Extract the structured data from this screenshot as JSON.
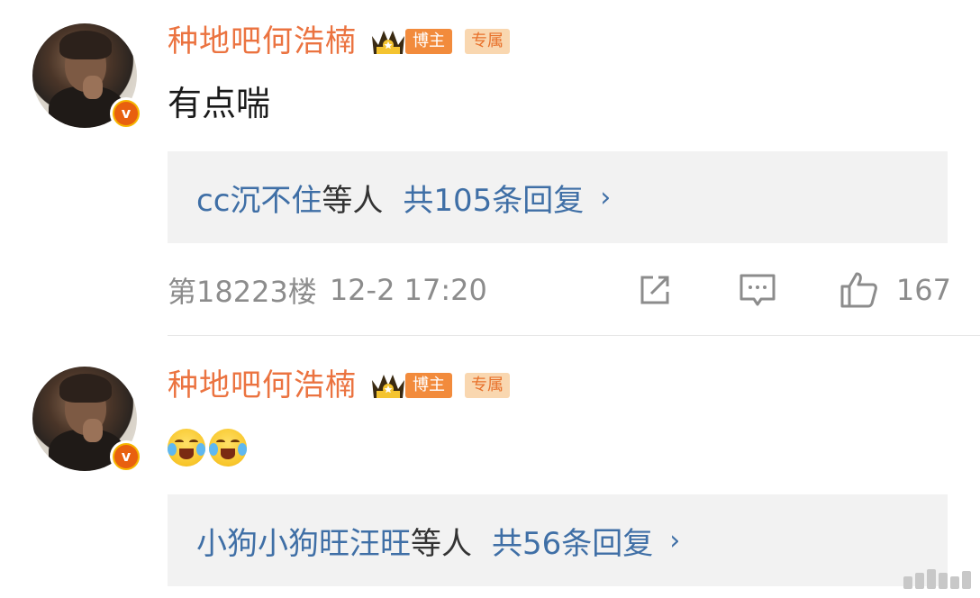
{
  "comments": [
    {
      "username": "种地吧何浩楠",
      "badge_blogger": "博主",
      "badge_exclusive": "专属",
      "text": "有点喘",
      "replies": {
        "names": "cc沉不住",
        "others": "等人",
        "count": "共105条回复",
        "chevron": "›"
      },
      "floor": "第18223楼",
      "time": "12-2 17:20",
      "likes": "167"
    },
    {
      "username": "种地吧何浩楠",
      "badge_blogger": "博主",
      "badge_exclusive": "专属",
      "emojis": [
        "laugh-cry-emoji",
        "laugh-cry-emoji"
      ],
      "replies": {
        "names": "小狗小狗旺汪旺",
        "others": "等人",
        "count": "共56条回复",
        "chevron": "›"
      }
    }
  ],
  "colors": {
    "username": "#eb7340",
    "link": "#3f6fa6",
    "meta": "#8c8c8c",
    "reply_bg": "#f2f2f2"
  },
  "verify_glyph": "v"
}
